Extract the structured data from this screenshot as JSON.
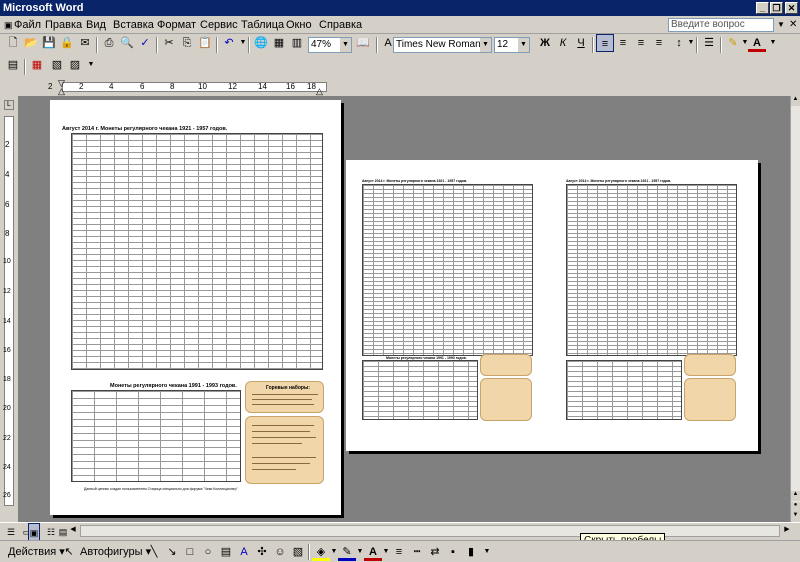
{
  "window": {
    "title": "Microsoft Word"
  },
  "menu": {
    "items": [
      "Файл",
      "Правка",
      "Вид",
      "Вставка",
      "Формат",
      "Сервис",
      "Таблица",
      "Окно",
      "Справка"
    ],
    "ask_placeholder": "Введите вопрос"
  },
  "toolbar": {
    "zoom": "47%",
    "font_name": "Times New Roman",
    "font_size": "12",
    "bold": "Ж",
    "italic": "К",
    "underline": "Ч"
  },
  "ruler": {
    "h_ticks": [
      "2",
      "2",
      "4",
      "6",
      "8",
      "10",
      "12",
      "14",
      "16",
      "18"
    ],
    "v_ticks": [
      "2",
      "4",
      "6",
      "8",
      "10",
      "12",
      "14",
      "16",
      "18",
      "20",
      "22",
      "24",
      "26"
    ]
  },
  "document": {
    "page1": {
      "heading": "Август 2014 г.      Монеты регулярного чекана 1921 - 1957 годов.",
      "heading2": "Монеты регулярного чекана 1991 - 1993 годов.",
      "note_title": "Горевые наборы:",
      "footer": "Данный ценник создан пользователем Старица специально для форума \"Чеки Коллекционер\""
    },
    "page2": {
      "heading": "Август 2014 г.      Монеты регулярного чекана 1921 - 1957 годов.",
      "heading2": "Монеты регулярного чекана 1991 - 1993 годов."
    },
    "page3": {
      "heading": "Август 2014 г.      Монеты регулярного чекана 1921 - 1957 годов."
    }
  },
  "tooltip": "Скрыть пробелы",
  "drawbar": {
    "actions": "Действия",
    "autoshapes": "Автофигуры"
  },
  "colors": {
    "title_bg": "#0a246a",
    "chrome": "#d4d0c8",
    "workspace": "#808080",
    "note": "#f0d6a8"
  }
}
